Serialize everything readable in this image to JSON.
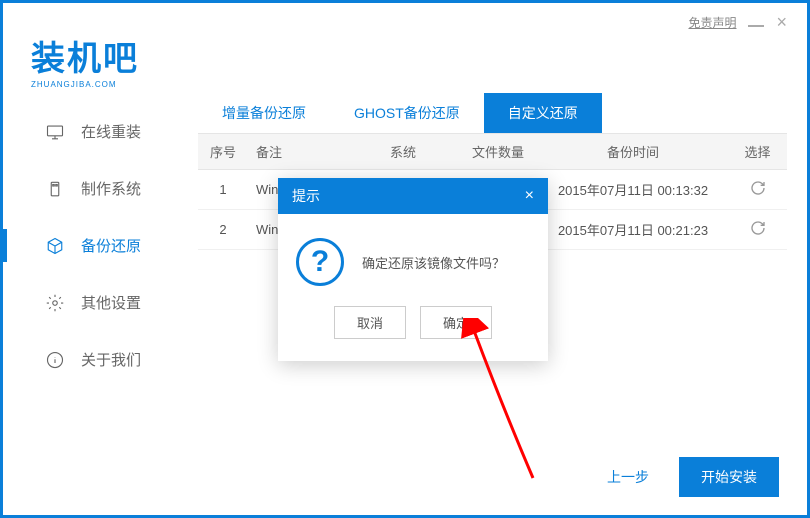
{
  "titlebar": {
    "disclaimer": "免责声明"
  },
  "logo": {
    "main": "装机吧",
    "sub": "ZHUANGJIBA.COM"
  },
  "sidebar": {
    "items": [
      {
        "label": "在线重装"
      },
      {
        "label": "制作系统"
      },
      {
        "label": "备份还原"
      },
      {
        "label": "其他设置"
      },
      {
        "label": "关于我们"
      }
    ]
  },
  "tabs": {
    "items": [
      {
        "label": "增量备份还原"
      },
      {
        "label": "GHOST备份还原"
      },
      {
        "label": "自定义还原"
      }
    ]
  },
  "table": {
    "headers": {
      "seq": "序号",
      "note": "备注",
      "sys": "系统",
      "count": "文件数量",
      "time": "备份时间",
      "sel": "选择"
    },
    "rows": [
      {
        "seq": "1",
        "note": "Wind",
        "time": "2015年07月11日 00:13:32"
      },
      {
        "seq": "2",
        "note": "Wind",
        "time": "2015年07月11日 00:21:23"
      }
    ]
  },
  "dialog": {
    "title": "提示",
    "message": "确定还原该镜像文件吗？",
    "cancel": "取消",
    "confirm": "确定"
  },
  "footer": {
    "prev": "上一步",
    "start": "开始安装"
  }
}
